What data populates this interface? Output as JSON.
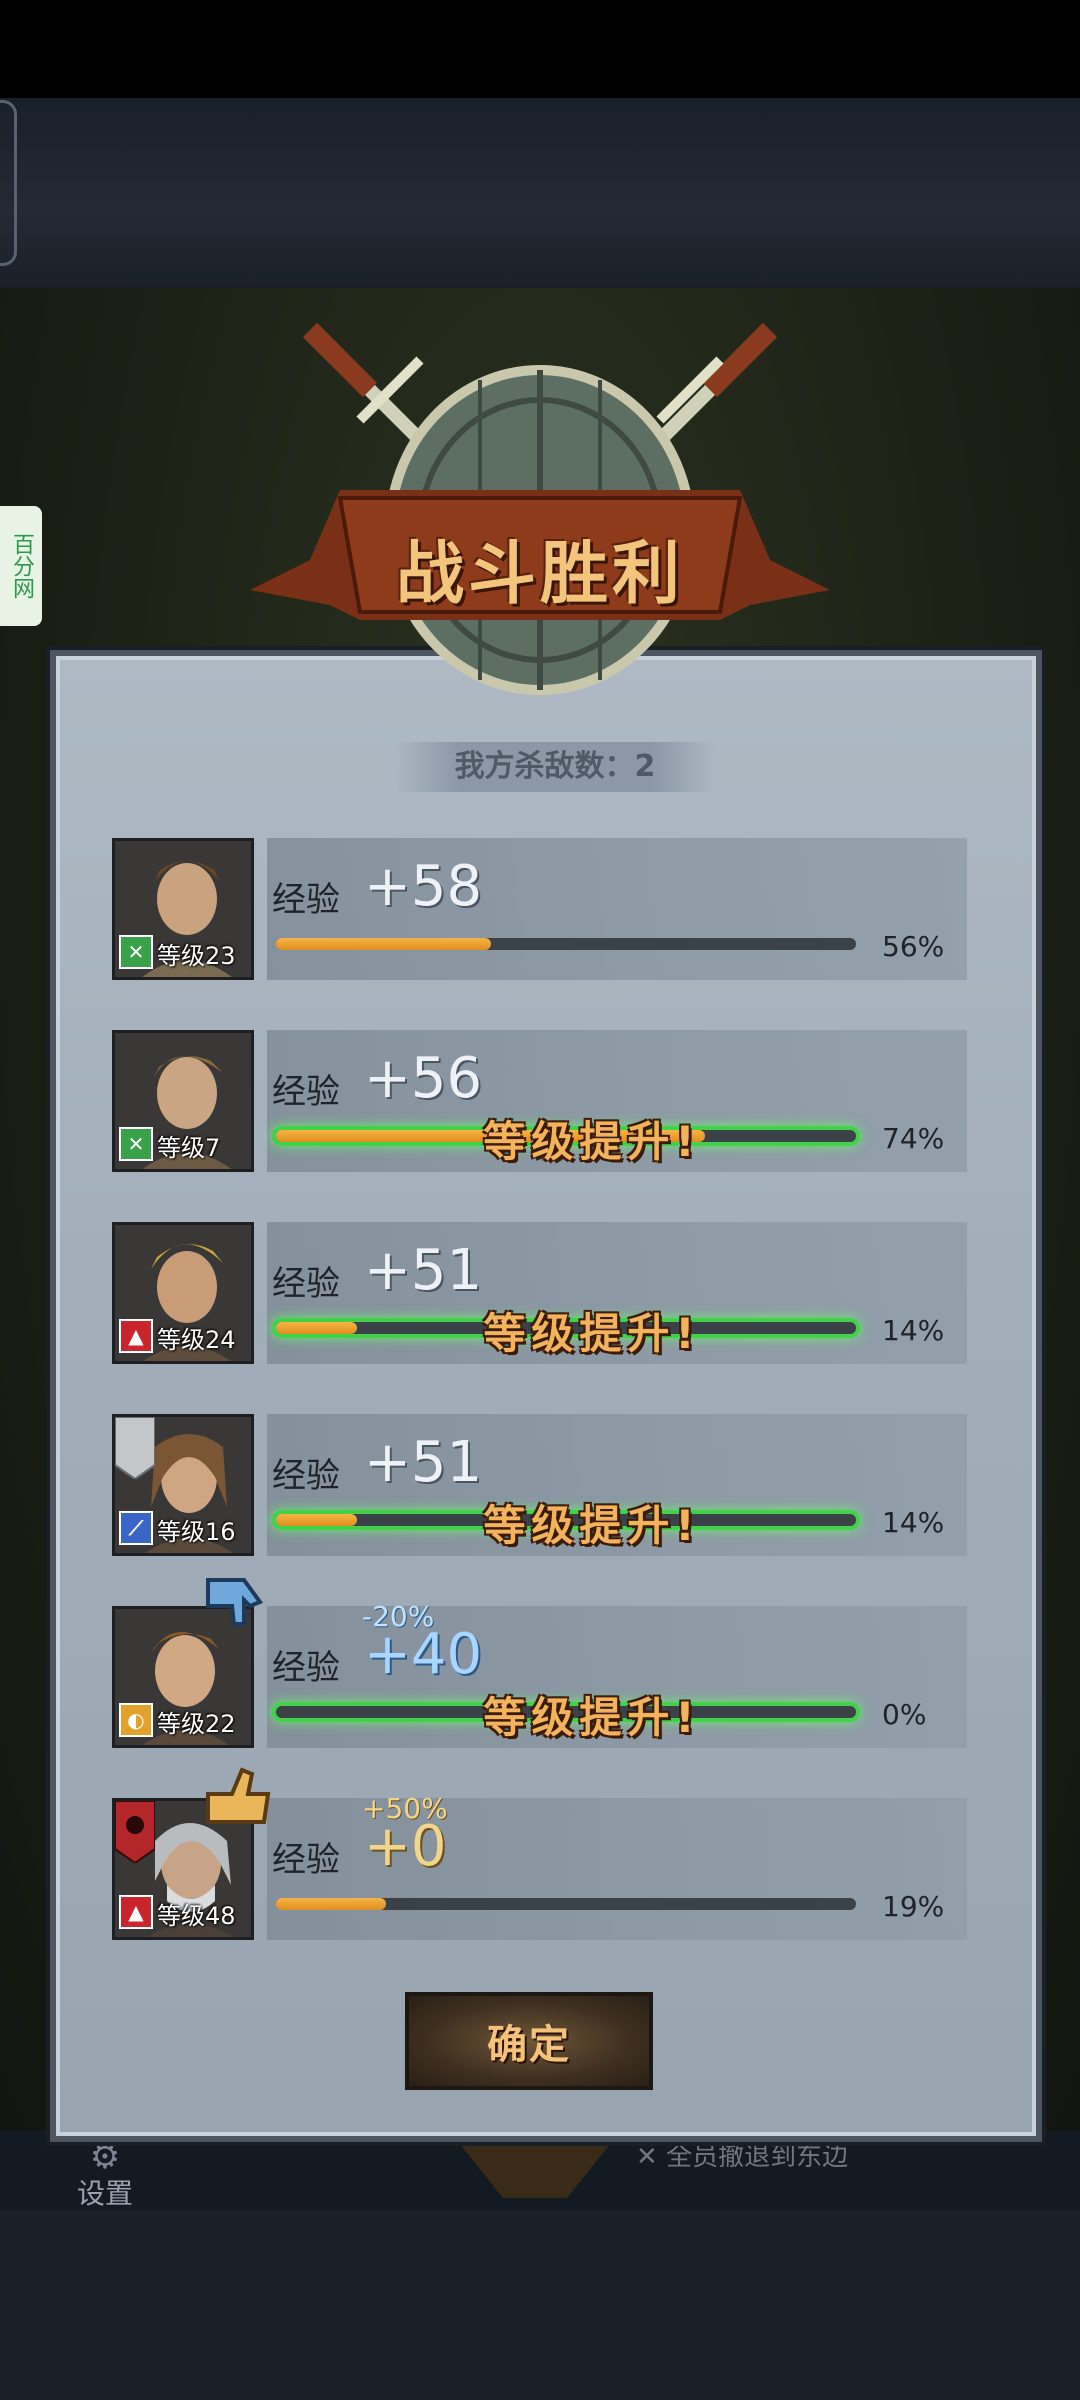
{
  "side_tab": "百分网",
  "banner_title": "战斗胜利",
  "kills_text": "我方杀敌数：2",
  "exp_label": "经验",
  "level_prefix": "等级",
  "level_up_text": "等级提升!",
  "confirm_label": "确定",
  "bottom": {
    "settings_label": "设置",
    "retreat_label": "全员撤退到东边"
  },
  "heroes": [
    {
      "level": "等级23",
      "exp": "+58",
      "percent_text": "56%",
      "progress": 0.37,
      "leveled_up": false,
      "class_icon": "crossed-swords-icon",
      "class_color": "#37a24a",
      "exp_style": "white"
    },
    {
      "level": "等级7",
      "exp": "+56",
      "percent_text": "74%",
      "progress": 0.74,
      "leveled_up": true,
      "class_icon": "crossed-swords-icon",
      "class_color": "#37a24a",
      "exp_style": "white"
    },
    {
      "level": "等级24",
      "exp": "+51",
      "percent_text": "14%",
      "progress": 0.14,
      "leveled_up": true,
      "class_icon": "wolf-icon",
      "class_color": "#c8262c",
      "exp_style": "white"
    },
    {
      "level": "等级16",
      "exp": "+51",
      "percent_text": "14%",
      "progress": 0.14,
      "leveled_up": true,
      "class_icon": "sword-icon",
      "class_color": "#3a66c8",
      "exp_style": "white"
    },
    {
      "level": "等级22",
      "exp": "+40",
      "modifier": "-20%",
      "percent_text": "0%",
      "progress": 0.0,
      "leveled_up": true,
      "class_icon": "shield-icon",
      "class_color": "#e2a12a",
      "exp_style": "blue",
      "thumb": "thumbs-down-icon"
    },
    {
      "level": "等级48",
      "exp": "+0",
      "modifier": "+50%",
      "percent_text": "19%",
      "progress": 0.19,
      "leveled_up": false,
      "class_icon": "wolf-icon",
      "class_color": "#c8262c",
      "exp_style": "gold",
      "thumb": "thumbs-up-icon"
    }
  ],
  "colors": {
    "exp_bar": "#e8961f",
    "level_up_glow": "#43d04a",
    "banner": "#8a3a1e"
  }
}
